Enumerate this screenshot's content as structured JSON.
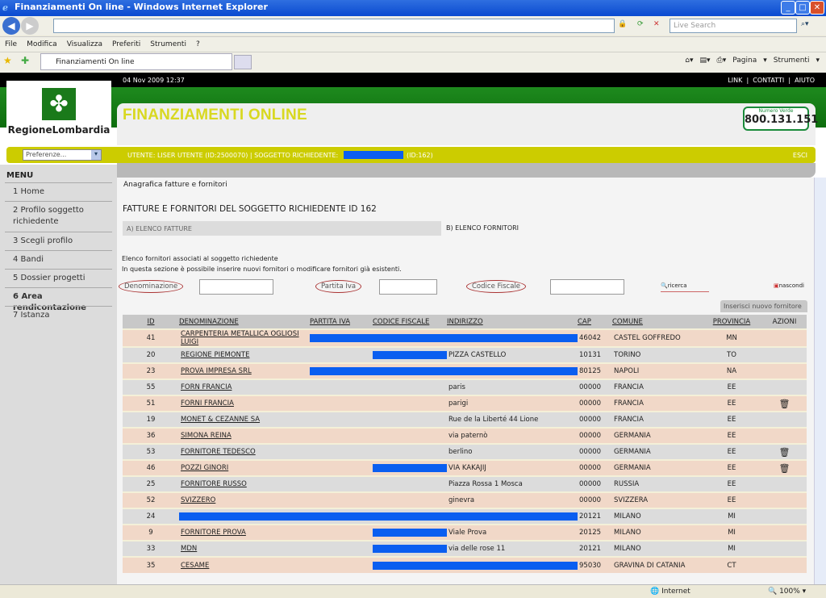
{
  "browser": {
    "title": "Finanziamenti On line - Windows Internet Explorer",
    "search_placeholder": "Live Search",
    "menu": [
      "File",
      "Modifica",
      "Visualizza",
      "Preferiti",
      "Strumenti",
      "?"
    ],
    "tab": "Finanziamenti On line",
    "tools": {
      "page": "Pagina",
      "tools": "Strumenti"
    },
    "status": {
      "zone": "Internet",
      "zoom": "100%"
    }
  },
  "site": {
    "datetime": "04 Nov 2009 12:37",
    "toplinks": [
      "LINK",
      "CONTATTI",
      "AIUTO"
    ],
    "logo_text": "RegioneLombardia",
    "title": "FINANZIAMENTI ONLINE",
    "phone_label": "Numero Verde",
    "phone": "800.131.151",
    "pref": "Preferenze...",
    "user": "UTENTE:  LISER UTENTE (ID:2500070)  |  SOGGETTO RICHIEDENTE:",
    "user_id": "(ID:162)",
    "logout": "ESCI",
    "accent": "#cccc00",
    "brand_green": "#1a7a1a"
  },
  "menu": {
    "title": "MENU",
    "items": [
      "1  Home",
      "2  Profilo soggetto richiedente",
      "3  Scegli profilo",
      "4  Bandi",
      "5  Dossier progetti",
      "6  Area rendicontazione",
      "7  Istanza"
    ],
    "active": 5
  },
  "main": {
    "breadcrumb": "Anagrafica fatture e fornitori",
    "heading": "FATTURE E FORNITORI DEL SOGGETTO RICHIEDENTE ID 162",
    "tab_a": "A) ELENCO FATTURE",
    "tab_b": "B) ELENCO FORNITORI",
    "desc1": "Elenco fornitori associati al soggetto richiedente",
    "desc2": "In questa sezione è possibile inserire nuovi fornitori o modificare fornitori già esistenti.",
    "filters": {
      "denominazione": "Denominazione",
      "piva": "Partita Iva",
      "cf": "Codice Fiscale",
      "search": "ricerca",
      "hide": "nascondi"
    },
    "new_button": "Inserisci nuovo fornitore",
    "columns": [
      "ID",
      "DENOMINAZIONE",
      "PARTITA IVA",
      "CODICE FISCALE",
      "INDIRIZZO",
      "CAP",
      "COMUNE",
      "PROVINCIA",
      "AZIONI"
    ],
    "rows": [
      {
        "id": "41",
        "name": "CARPENTERIA METALLICA OGLIOSI LUIGI",
        "addr": "",
        "cap": "46042",
        "comune": "CASTEL GOFFREDO",
        "prov": "MN",
        "redacted": [
          "piva",
          "cf",
          "addr"
        ],
        "delete": false
      },
      {
        "id": "20",
        "name": "REGIONE PIEMONTE",
        "addr": "PIZZA CASTELLO",
        "cap": "10131",
        "comune": "TORINO",
        "prov": "TO",
        "redacted": [
          "cf"
        ],
        "delete": false
      },
      {
        "id": "23",
        "name": "PROVA IMPRESA SRL",
        "addr": "",
        "cap": "80125",
        "comune": "NAPOLI",
        "prov": "NA",
        "redacted": [
          "piva",
          "cf",
          "addr"
        ],
        "delete": false
      },
      {
        "id": "55",
        "name": "FORN FRANCIA",
        "addr": "paris",
        "cap": "00000",
        "comune": "FRANCIA",
        "prov": "EE",
        "redacted": [],
        "delete": false
      },
      {
        "id": "51",
        "name": "FORNI FRANCIA",
        "addr": "parigi",
        "cap": "00000",
        "comune": "FRANCIA",
        "prov": "EE",
        "redacted": [],
        "delete": true
      },
      {
        "id": "19",
        "name": "MONET & CEZANNE SA",
        "addr": "Rue de la Liberté 44 Lione",
        "cap": "00000",
        "comune": "FRANCIA",
        "prov": "EE",
        "redacted": [],
        "delete": false
      },
      {
        "id": "36",
        "name": "SIMONA REINA",
        "addr": "via paternò",
        "cap": "00000",
        "comune": "GERMANIA",
        "prov": "EE",
        "redacted": [],
        "delete": false
      },
      {
        "id": "53",
        "name": "FORNITORE TEDESCO",
        "addr": "berlino",
        "cap": "00000",
        "comune": "GERMANIA",
        "prov": "EE",
        "redacted": [],
        "delete": true
      },
      {
        "id": "46",
        "name": "POZZI GINORI",
        "addr": "VIA KAKAJIJ",
        "cap": "00000",
        "comune": "GERMANIA",
        "prov": "EE",
        "redacted": [
          "cf"
        ],
        "delete": true
      },
      {
        "id": "25",
        "name": "FORNITORE RUSSO",
        "addr": "Piazza Rossa 1 Mosca",
        "cap": "00000",
        "comune": "RUSSIA",
        "prov": "EE",
        "redacted": [],
        "delete": false
      },
      {
        "id": "52",
        "name": "SVIZZERO",
        "addr": "ginevra",
        "cap": "00000",
        "comune": "SVIZZERA",
        "prov": "EE",
        "redacted": [],
        "delete": false
      },
      {
        "id": "24",
        "name": "",
        "addr": "",
        "cap": "20121",
        "comune": "MILANO",
        "prov": "MI",
        "redacted": [
          "name",
          "piva",
          "cf",
          "addr"
        ],
        "delete": false
      },
      {
        "id": "9",
        "name": "FORNITORE PROVA",
        "addr": "Viale Prova",
        "cap": "20125",
        "comune": "MILANO",
        "prov": "MI",
        "redacted": [
          "cf"
        ],
        "delete": false
      },
      {
        "id": "33",
        "name": "MDN",
        "addr": "via delle rose 11",
        "cap": "20121",
        "comune": "MILANO",
        "prov": "MI",
        "redacted": [
          "cf"
        ],
        "delete": false
      },
      {
        "id": "35",
        "name": "CESAME",
        "addr": "",
        "cap": "95030",
        "comune": "GRAVINA DI CATANIA",
        "prov": "CT",
        "redacted": [
          "cf",
          "addr"
        ],
        "delete": false
      }
    ]
  }
}
